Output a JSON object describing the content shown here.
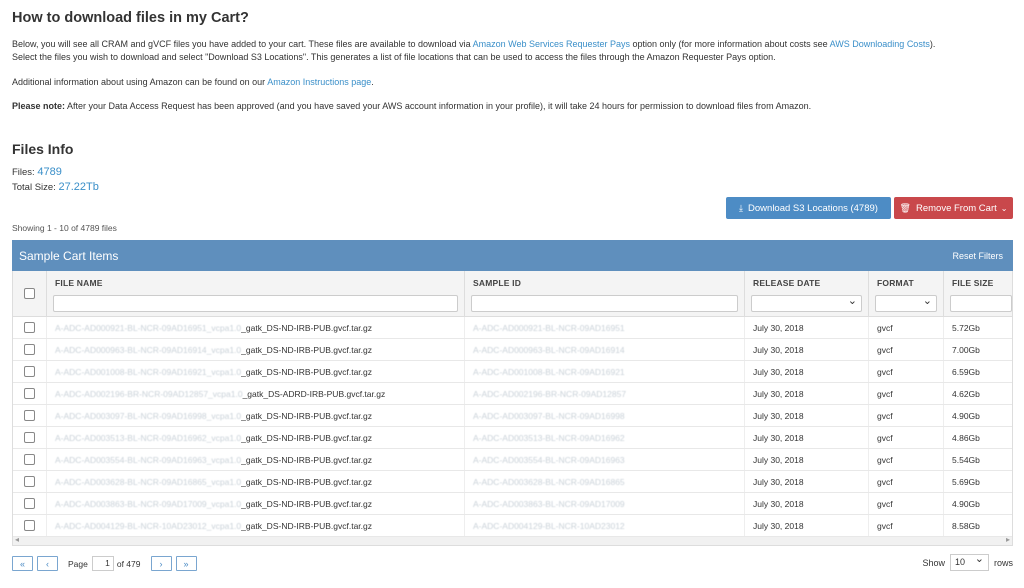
{
  "header": {
    "title": "How to download files in my Cart?"
  },
  "intro": {
    "p1_a": "Below, you will see all CRAM and gVCF files you have added to your cart. These files are available to download via ",
    "p1_link1": "Amazon Web Services Requester Pays",
    "p1_b": " option only (for more information about costs see ",
    "p1_link2": "AWS Downloading Costs",
    "p1_c": ").",
    "p1_line2": "Select the files you wish to download and select \"Download S3 Locations\". This generates a list of file locations that can be used to access the files through the Amazon Requester Pays option.",
    "p2_a": "Additional information about using Amazon can be found on our ",
    "p2_link": "Amazon Instructions page",
    "p2_b": ".",
    "note_label": "Please note:",
    "note_text": " After your Data Access Request has been approved (and you have saved your AWS account information in your profile), it will take 24 hours for permission to download files from Amazon."
  },
  "files_info": {
    "title": "Files Info",
    "files_label": "Files: ",
    "files_count": "4789",
    "size_label": "Total Size: ",
    "size_value": "27.22Tb"
  },
  "actions": {
    "download_label": "Download S3 Locations (4789)",
    "remove_label": "Remove From Cart"
  },
  "showing": "Showing 1 - 10 of 4789 files",
  "grid": {
    "title": "Sample Cart Items",
    "reset_label": "Reset Filters",
    "columns": [
      "FILE NAME",
      "SAMPLE ID",
      "RELEASE DATE",
      "FORMAT",
      "FILE SIZE"
    ],
    "rows": [
      {
        "file_blur": "A-ADC-AD000921-BL-NCR-09AD16951_vcpa1.0",
        "file_suffix": "_gatk_DS-ND-IRB-PUB.gvcf.tar.gz",
        "sample": "A-ADC-AD000921-BL-NCR-09AD16951",
        "date": "July 30, 2018",
        "format": "gvcf",
        "size": "5.72Gb"
      },
      {
        "file_blur": "A-ADC-AD000963-BL-NCR-09AD16914_vcpa1.0",
        "file_suffix": "_gatk_DS-ND-IRB-PUB.gvcf.tar.gz",
        "sample": "A-ADC-AD000963-BL-NCR-09AD16914",
        "date": "July 30, 2018",
        "format": "gvcf",
        "size": "7.00Gb"
      },
      {
        "file_blur": "A-ADC-AD001008-BL-NCR-09AD16921_vcpa1.0",
        "file_suffix": "_gatk_DS-ND-IRB-PUB.gvcf.tar.gz",
        "sample": "A-ADC-AD001008-BL-NCR-09AD16921",
        "date": "July 30, 2018",
        "format": "gvcf",
        "size": "6.59Gb"
      },
      {
        "file_blur": "A-ADC-AD002196-BR-NCR-09AD12857_vcpa1.0",
        "file_suffix": "_gatk_DS-ADRD-IRB-PUB.gvcf.tar.gz",
        "sample": "A-ADC-AD002196-BR-NCR-09AD12857",
        "date": "July 30, 2018",
        "format": "gvcf",
        "size": "4.62Gb"
      },
      {
        "file_blur": "A-ADC-AD003097-BL-NCR-09AD16998_vcpa1.0",
        "file_suffix": "_gatk_DS-ND-IRB-PUB.gvcf.tar.gz",
        "sample": "A-ADC-AD003097-BL-NCR-09AD16998",
        "date": "July 30, 2018",
        "format": "gvcf",
        "size": "4.90Gb"
      },
      {
        "file_blur": "A-ADC-AD003513-BL-NCR-09AD16962_vcpa1.0",
        "file_suffix": "_gatk_DS-ND-IRB-PUB.gvcf.tar.gz",
        "sample": "A-ADC-AD003513-BL-NCR-09AD16962",
        "date": "July 30, 2018",
        "format": "gvcf",
        "size": "4.86Gb"
      },
      {
        "file_blur": "A-ADC-AD003554-BL-NCR-09AD16963_vcpa1.0",
        "file_suffix": "_gatk_DS-ND-IRB-PUB.gvcf.tar.gz",
        "sample": "A-ADC-AD003554-BL-NCR-09AD16963",
        "date": "July 30, 2018",
        "format": "gvcf",
        "size": "5.54Gb"
      },
      {
        "file_blur": "A-ADC-AD003628-BL-NCR-09AD16865_vcpa1.0",
        "file_suffix": "_gatk_DS-ND-IRB-PUB.gvcf.tar.gz",
        "sample": "A-ADC-AD003628-BL-NCR-09AD16865",
        "date": "July 30, 2018",
        "format": "gvcf",
        "size": "5.69Gb"
      },
      {
        "file_blur": "A-ADC-AD003863-BL-NCR-09AD17009_vcpa1.0",
        "file_suffix": "_gatk_DS-ND-IRB-PUB.gvcf.tar.gz",
        "sample": "A-ADC-AD003863-BL-NCR-09AD17009",
        "date": "July 30, 2018",
        "format": "gvcf",
        "size": "4.90Gb"
      },
      {
        "file_blur": "A-ADC-AD004129-BL-NCR-10AD23012_vcpa1.0",
        "file_suffix": "_gatk_DS-ND-IRB-PUB.gvcf.tar.gz",
        "sample": "A-ADC-AD004129-BL-NCR-10AD23012",
        "date": "July 30, 2018",
        "format": "gvcf",
        "size": "8.58Gb"
      }
    ]
  },
  "pager": {
    "first": "«",
    "prev": "‹",
    "page_label": "Page",
    "page_value": "1",
    "of_label": "of 479",
    "next": "›",
    "last": "»"
  },
  "rows_ctl": {
    "show_label": "Show",
    "value": "10",
    "rows_label": "rows"
  },
  "icons": {
    "download": "download-icon",
    "trash": "trash-icon",
    "chevron": "chevron-down-icon"
  },
  "colors": {
    "primary": "#4d8cc5",
    "danger": "#c9484b",
    "panel": "#5f8fbd",
    "link": "#3a8fc9"
  }
}
